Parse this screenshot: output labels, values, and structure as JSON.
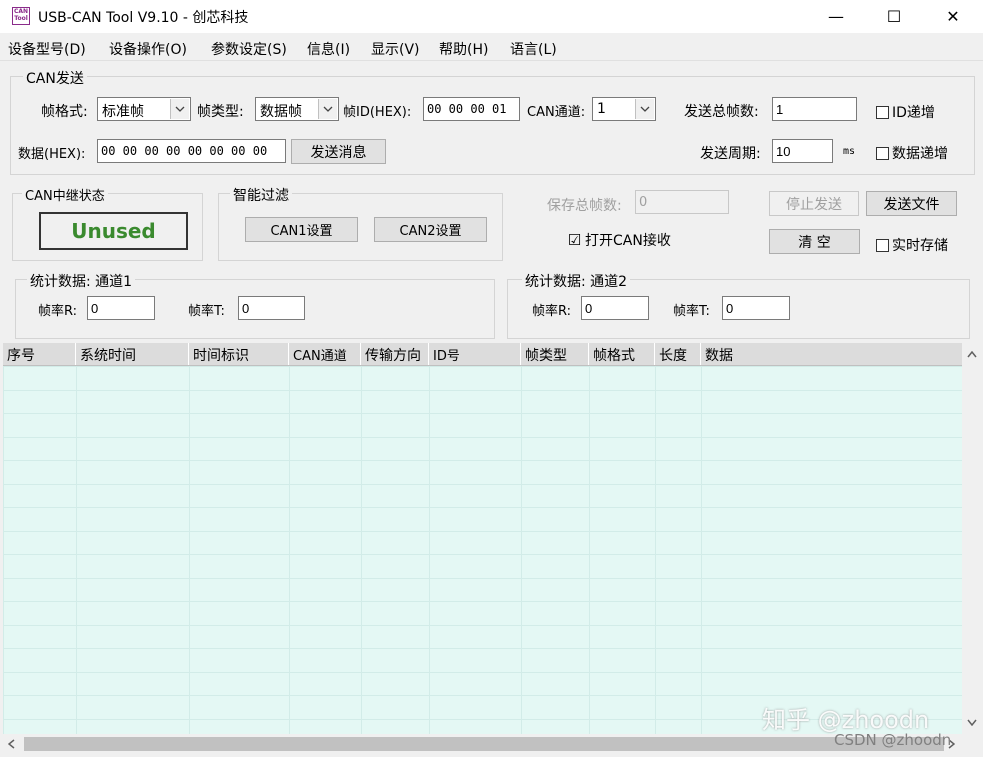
{
  "window": {
    "icon_text": "CAN Tool",
    "title": "USB-CAN Tool V9.10 - 创芯科技",
    "minimize": "—",
    "maximize": "☐",
    "close": "✕"
  },
  "menu": [
    "设备型号(D)",
    "设备操作(O)",
    "参数设定(S)",
    "信息(I)",
    "显示(V)",
    "帮助(H)",
    "语言(L)"
  ],
  "send_group": {
    "title": "CAN发送",
    "frame_format_label": "帧格式:",
    "frame_format_value": "标准帧",
    "frame_type_label": "帧类型:",
    "frame_type_value": "数据帧",
    "frame_id_label": "帧ID(HEX):",
    "frame_id_value": "00 00 00 01",
    "can_channel_label": "CAN通道:",
    "can_channel_value": "1",
    "total_frames_label": "发送总帧数:",
    "total_frames_value": "1",
    "id_increment_label": "ID递增",
    "id_increment_checked": false,
    "data_label": "数据(HEX):",
    "data_value": "00 00 00 00 00 00 00 00",
    "send_button": "发送消息",
    "period_label": "发送周期:",
    "period_value": "10",
    "period_unit": "ms",
    "data_increment_label": "数据递增",
    "data_increment_checked": false
  },
  "relay_group": {
    "title": "CAN中继状态",
    "status": "Unused",
    "status_color": "#3a8a2e"
  },
  "filter_group": {
    "title": "智能过滤",
    "can1_button": "CAN1设置",
    "can2_button": "CAN2设置"
  },
  "controls": {
    "saved_frames_label": "保存总帧数:",
    "saved_frames_value": "0",
    "stop_send_button": "停止发送",
    "send_file_button": "发送文件",
    "open_receive_label": "打开CAN接收",
    "open_receive_checked": true,
    "check_mark": "☑",
    "clear_button": "清 空",
    "realtime_save_label": "实时存储",
    "realtime_save_checked": false
  },
  "stats1": {
    "title": "统计数据: 通道1",
    "rate_r_label": "帧率R:",
    "rate_r_value": "0",
    "rate_t_label": "帧率T:",
    "rate_t_value": "0"
  },
  "stats2": {
    "title": "统计数据: 通道2",
    "rate_r_label": "帧率R:",
    "rate_r_value": "0",
    "rate_t_label": "帧率T:",
    "rate_t_value": "0"
  },
  "table": {
    "columns": [
      "序号",
      "系统时间",
      "时间标识",
      "CAN通道",
      "传输方向",
      "ID号",
      "帧类型",
      "帧格式",
      "长度",
      "数据"
    ],
    "rows": []
  },
  "scroll": {
    "up": "▲",
    "down": "▼",
    "left": "◀",
    "right": "▶"
  },
  "watermark": {
    "main": "知乎 @zhoodn",
    "sub": "CSDN @zhoodn"
  }
}
